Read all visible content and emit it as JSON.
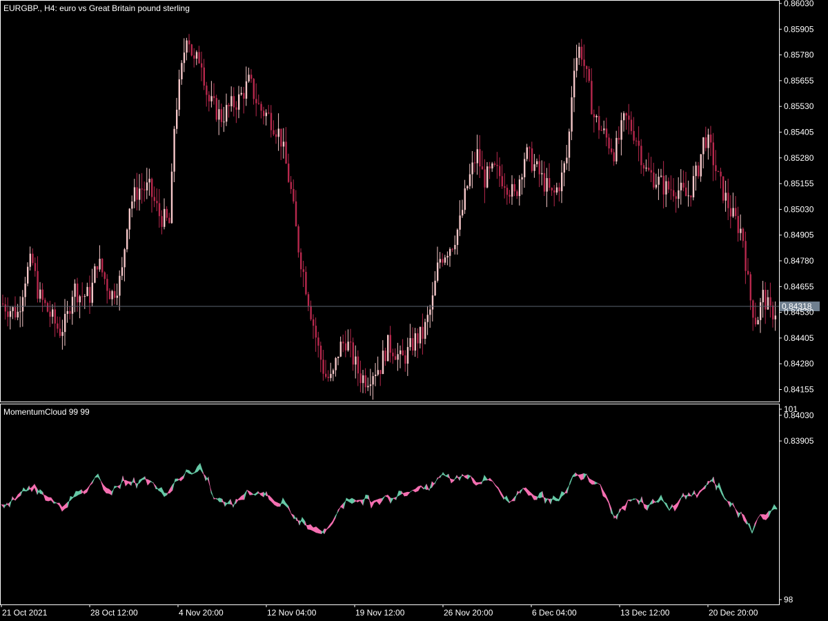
{
  "colors": {
    "background": "#000000",
    "border": "#ffffff",
    "bull_candle": "#f6c7c9",
    "bear_candle": "#b8284d",
    "cloud_up": "#66c9a6",
    "cloud_down": "#f56fb1",
    "current_price_line": "#5b6471",
    "current_price_badge": "#6f7f8f"
  },
  "price_chart": {
    "title": "EURGBP., H4:  euro vs Great Britain pound sterling",
    "current_price": "0.84318",
    "y_tick_labels": [
      "0.86030",
      "0.85905",
      "0.85780",
      "0.85655",
      "0.85530",
      "0.85405",
      "0.85280",
      "0.85155",
      "0.85030",
      "0.84905",
      "0.84780",
      "0.84655",
      "0.84530",
      "0.84405",
      "0.84280",
      "0.84155",
      "0.84030",
      "0.83905"
    ]
  },
  "indicator": {
    "title": "MomentumCloud 99 99",
    "y_tick_labels": [
      "101",
      "98"
    ]
  },
  "x_axis": {
    "tick_labels": [
      "21 Oct 2021",
      "28 Oct 12:00",
      "4 Nov 20:00",
      "12 Nov 04:00",
      "19 Nov 12:00",
      "26 Nov 20:00",
      "6 Dec 04:00",
      "13 Dec 12:00",
      "20 Dec 20:00"
    ]
  },
  "chart_data": [
    {
      "type": "candlestick",
      "title": "EURGBP., H4:  euro vs Great Britain pound sterling",
      "ylim": [
        0.8385,
        0.8604
      ],
      "current_price": 0.84318,
      "x": [
        "21 Oct 2021",
        "28 Oct 12:00",
        "4 Nov 20:00",
        "12 Nov 04:00",
        "19 Nov 12:00",
        "26 Nov 20:00",
        "6 Dec 04:00",
        "13 Dec 12:00",
        "20 Dec 20:00"
      ],
      "close_path": [
        [
          0,
          0.8436
        ],
        [
          10,
          0.8433
        ],
        [
          25,
          0.843
        ],
        [
          35,
          0.845
        ],
        [
          45,
          0.846
        ],
        [
          55,
          0.844
        ],
        [
          70,
          0.843
        ],
        [
          85,
          0.842
        ],
        [
          95,
          0.8425
        ],
        [
          105,
          0.8445
        ],
        [
          115,
          0.844
        ],
        [
          130,
          0.844
        ],
        [
          140,
          0.846
        ],
        [
          160,
          0.844
        ],
        [
          175,
          0.845
        ],
        [
          185,
          0.849
        ],
        [
          200,
          0.85
        ],
        [
          215,
          0.85
        ],
        [
          230,
          0.8485
        ],
        [
          245,
          0.848
        ],
        [
          252,
          0.854
        ],
        [
          260,
          0.856
        ],
        [
          270,
          0.859
        ],
        [
          280,
          0.857
        ],
        [
          290,
          0.8575
        ],
        [
          300,
          0.855
        ],
        [
          310,
          0.8545
        ],
        [
          320,
          0.854
        ],
        [
          330,
          0.8545
        ],
        [
          345,
          0.855
        ],
        [
          360,
          0.856
        ],
        [
          375,
          0.8545
        ],
        [
          390,
          0.854
        ],
        [
          405,
          0.853
        ],
        [
          420,
          0.85
        ],
        [
          430,
          0.847
        ],
        [
          440,
          0.845
        ],
        [
          450,
          0.843
        ],
        [
          460,
          0.841
        ],
        [
          470,
          0.8395
        ],
        [
          480,
          0.8392
        ],
        [
          490,
          0.841
        ],
        [
          500,
          0.8415
        ],
        [
          510,
          0.8405
        ],
        [
          520,
          0.8395
        ],
        [
          530,
          0.8393
        ],
        [
          540,
          0.8398
        ],
        [
          550,
          0.84
        ],
        [
          560,
          0.8412
        ],
        [
          570,
          0.841
        ],
        [
          580,
          0.8403
        ],
        [
          590,
          0.8408
        ],
        [
          600,
          0.8415
        ],
        [
          612,
          0.8418
        ],
        [
          625,
          0.8435
        ],
        [
          635,
          0.846
        ],
        [
          645,
          0.8465
        ],
        [
          655,
          0.847
        ],
        [
          665,
          0.848
        ],
        [
          675,
          0.85
        ],
        [
          690,
          0.852
        ],
        [
          700,
          0.8505
        ],
        [
          715,
          0.851
        ],
        [
          730,
          0.8505
        ],
        [
          745,
          0.8495
        ],
        [
          760,
          0.852
        ],
        [
          770,
          0.8515
        ],
        [
          785,
          0.8505
        ],
        [
          800,
          0.8495
        ],
        [
          812,
          0.8505
        ],
        [
          822,
          0.852
        ],
        [
          830,
          0.857
        ],
        [
          840,
          0.858
        ],
        [
          850,
          0.856
        ],
        [
          860,
          0.854
        ],
        [
          875,
          0.853
        ],
        [
          890,
          0.852
        ],
        [
          905,
          0.854
        ],
        [
          920,
          0.853
        ],
        [
          935,
          0.851
        ],
        [
          950,
          0.8505
        ],
        [
          965,
          0.85
        ],
        [
          980,
          0.85
        ],
        [
          995,
          0.8495
        ],
        [
          1010,
          0.851
        ],
        [
          1020,
          0.853
        ],
        [
          1030,
          0.852
        ],
        [
          1040,
          0.8505
        ],
        [
          1050,
          0.8495
        ],
        [
          1060,
          0.8485
        ],
        [
          1075,
          0.8475
        ],
        [
          1085,
          0.844
        ],
        [
          1095,
          0.8425
        ],
        [
          1105,
          0.844
        ],
        [
          1115,
          0.843
        ],
        [
          1125,
          0.8432
        ]
      ]
    },
    {
      "type": "area",
      "title": "MomentumCloud 99 99",
      "ylim": [
        98,
        101
      ],
      "series": [
        {
          "values_path": [
            [
              0,
              99.5
            ],
            [
              10,
              99.48
            ],
            [
              20,
              99.58
            ],
            [
              30,
              99.68
            ],
            [
              40,
              99.72
            ],
            [
              50,
              99.8
            ],
            [
              60,
              99.66
            ],
            [
              70,
              99.62
            ],
            [
              80,
              99.55
            ],
            [
              90,
              99.47
            ],
            [
              100,
              99.56
            ],
            [
              110,
              99.64
            ],
            [
              120,
              99.67
            ],
            [
              130,
              99.78
            ],
            [
              140,
              99.95
            ],
            [
              150,
              99.82
            ],
            [
              160,
              99.7
            ],
            [
              170,
              99.78
            ],
            [
              180,
              99.88
            ],
            [
              190,
              99.85
            ],
            [
              200,
              99.82
            ],
            [
              210,
              99.9
            ],
            [
              220,
              99.85
            ],
            [
              230,
              99.72
            ],
            [
              240,
              99.62
            ],
            [
              250,
              99.8
            ],
            [
              260,
              99.92
            ],
            [
              270,
              100.0
            ],
            [
              280,
              99.96
            ],
            [
              290,
              100.05
            ],
            [
              300,
              99.93
            ],
            [
              310,
              99.6
            ],
            [
              320,
              99.55
            ],
            [
              330,
              99.52
            ],
            [
              340,
              99.5
            ],
            [
              350,
              99.65
            ],
            [
              360,
              99.72
            ],
            [
              370,
              99.65
            ],
            [
              380,
              99.7
            ],
            [
              390,
              99.62
            ],
            [
              400,
              99.55
            ],
            [
              410,
              99.5
            ],
            [
              420,
              99.4
            ],
            [
              430,
              99.26
            ],
            [
              440,
              99.2
            ],
            [
              450,
              99.17
            ],
            [
              460,
              99.12
            ],
            [
              470,
              99.05
            ],
            [
              480,
              99.2
            ],
            [
              490,
              99.4
            ],
            [
              500,
              99.56
            ],
            [
              510,
              99.52
            ],
            [
              520,
              99.58
            ],
            [
              530,
              99.6
            ],
            [
              540,
              99.53
            ],
            [
              550,
              99.57
            ],
            [
              560,
              99.64
            ],
            [
              570,
              99.6
            ],
            [
              580,
              99.66
            ],
            [
              590,
              99.7
            ],
            [
              600,
              99.72
            ],
            [
              610,
              99.8
            ],
            [
              620,
              99.7
            ],
            [
              630,
              99.84
            ],
            [
              640,
              100.0
            ],
            [
              650,
              99.92
            ],
            [
              660,
              99.9
            ],
            [
              670,
              99.93
            ],
            [
              680,
              99.98
            ],
            [
              690,
              99.85
            ],
            [
              700,
              99.85
            ],
            [
              710,
              99.9
            ],
            [
              720,
              99.8
            ],
            [
              730,
              99.62
            ],
            [
              740,
              99.52
            ],
            [
              750,
              99.65
            ],
            [
              760,
              99.78
            ],
            [
              770,
              99.67
            ],
            [
              780,
              99.62
            ],
            [
              790,
              99.6
            ],
            [
              800,
              99.58
            ],
            [
              810,
              99.57
            ],
            [
              820,
              99.7
            ],
            [
              830,
              99.92
            ],
            [
              840,
              99.98
            ],
            [
              850,
              99.96
            ],
            [
              860,
              99.86
            ],
            [
              870,
              99.82
            ],
            [
              880,
              99.6
            ],
            [
              890,
              99.3
            ],
            [
              900,
              99.42
            ],
            [
              910,
              99.55
            ],
            [
              920,
              99.58
            ],
            [
              930,
              99.52
            ],
            [
              940,
              99.48
            ],
            [
              950,
              99.53
            ],
            [
              960,
              99.57
            ],
            [
              970,
              99.4
            ],
            [
              980,
              99.52
            ],
            [
              990,
              99.62
            ],
            [
              1000,
              99.65
            ],
            [
              1010,
              99.66
            ],
            [
              1020,
              99.76
            ],
            [
              1030,
              99.88
            ],
            [
              1040,
              99.78
            ],
            [
              1050,
              99.6
            ],
            [
              1060,
              99.52
            ],
            [
              1070,
              99.38
            ],
            [
              1080,
              99.3
            ],
            [
              1090,
              99.05
            ],
            [
              1100,
              99.32
            ],
            [
              1110,
              99.35
            ],
            [
              1120,
              99.42
            ]
          ]
        }
      ]
    }
  ]
}
